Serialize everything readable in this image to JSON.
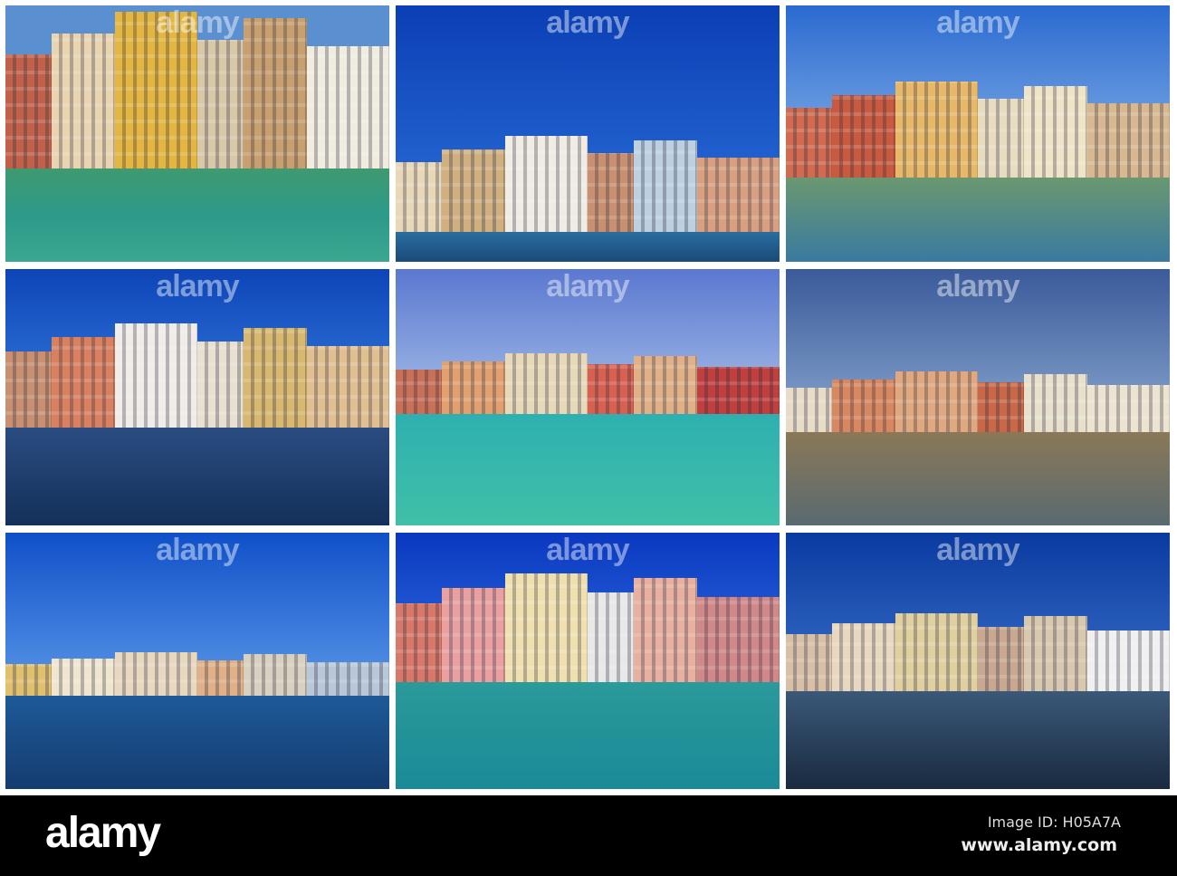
{
  "watermark": "alamy",
  "tiles": [
    {
      "sky": "#5a8fd0",
      "bld": [
        "#c0624a",
        "#e8d4b0",
        "#e2b640",
        "#d8c8a8",
        "#c8a070",
        "#f0ece0"
      ],
      "water": "linear-gradient(#3e9a70,#2d9a8a 50%,#3aa890)",
      "skyH": 0,
      "bldH": 180
    },
    {
      "sky": "linear-gradient(#0b3fb5,#2a6fd8)",
      "bld": [
        "#e8d8b8",
        "#d0b080",
        "#f0ece4",
        "#c89070",
        "#bcd0e0",
        "#d8a080"
      ],
      "water": "linear-gradient(#2a6ea0,#1a4a78)",
      "skyH": 140,
      "bldH": 110
    },
    {
      "sky": "linear-gradient(#2a6ad0,#8ab4e8)",
      "bld": [
        "#d06a50",
        "#c85a40",
        "#e6b868",
        "#e8dcc0",
        "#f0e4c8",
        "#d8b890"
      ],
      "water": "linear-gradient(#6a9870,#3a7aa0)",
      "skyH": 80,
      "bldH": 110
    },
    {
      "sky": "linear-gradient(#0d45b8,#3a80e0)",
      "bld": [
        "#c89070",
        "#d88060",
        "#f0ece8",
        "#e8e0d0",
        "#d8b870",
        "#e0c090"
      ],
      "water": "linear-gradient(#2a4c80,#14305a)",
      "skyH": 55,
      "bldH": 120
    },
    {
      "sky": "linear-gradient(#5a78d0,#a8c0e8)",
      "bld": [
        "#c87058",
        "#e0a070",
        "#e6d8b8",
        "#d86050",
        "#e0b088",
        "#c04040"
      ],
      "water": "linear-gradient(#2eb0b0,#40c0a8)",
      "skyH": 90,
      "bldH": 70
    },
    {
      "sky": "linear-gradient(#3a5a9a,#8aa8d0)",
      "bld": [
        "#e8dcc8",
        "#d88860",
        "#e0a880",
        "#c86848",
        "#e8e0cc",
        "#ece4d0"
      ],
      "water": "linear-gradient(#8a7858,#5a6a70)",
      "skyH": 110,
      "bldH": 70
    },
    {
      "sky": "linear-gradient(#1050c8,#5a98e8)",
      "bld": [
        "#e0c070",
        "#f0e6d0",
        "#e8d8c0",
        "#e0b088",
        "#d8d0c0",
        "#b8c8d8"
      ],
      "water": "linear-gradient(#1e5a98,#143c70)",
      "skyH": 130,
      "bldH": 50
    },
    {
      "sky": "linear-gradient(#0a38c0,#3070e0)",
      "bld": [
        "#d87868",
        "#e8a0a0",
        "#f0e0b0",
        "#e8e8e8",
        "#e8b0a0",
        "#d08888"
      ],
      "water": "linear-gradient(#2a9a9a,#1a8a98)",
      "skyH": 40,
      "bldH": 125
    },
    {
      "sky": "linear-gradient(#0a3aa0,#3a70c8)",
      "bld": [
        "#d8c0a8",
        "#e8d8c0",
        "#e0d0a0",
        "#c8a890",
        "#d8c8b0",
        "#f0f0f0"
      ],
      "water": "linear-gradient(#3a5878,#1a2a40)",
      "skyH": 85,
      "bldH": 90
    }
  ],
  "footer": {
    "logo": "alamy",
    "image_id": "Image ID: H05A7A",
    "url": "www.alamy.com"
  }
}
